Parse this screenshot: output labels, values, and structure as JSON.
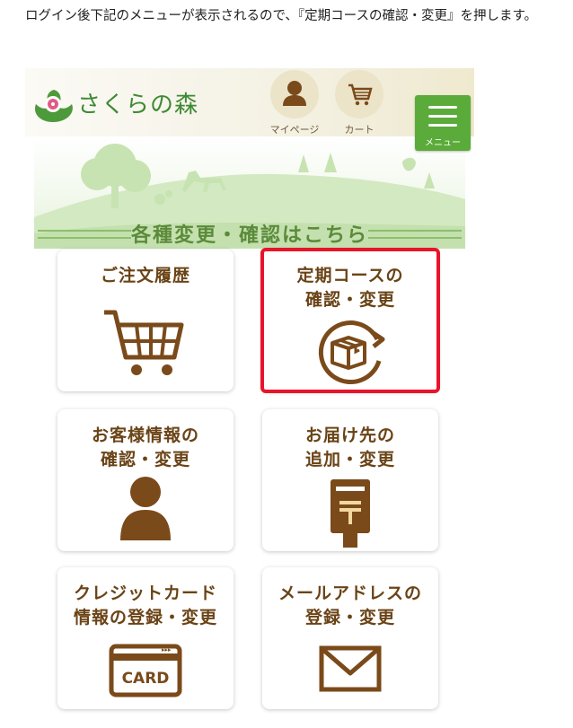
{
  "intro": {
    "text": "ログイン後下記のメニューが表示されるので、『定期コースの確認・変更』を押します。"
  },
  "header": {
    "logo_text": "さくらの森",
    "mypage_label": "マイページ",
    "cart_label": "カート",
    "menu_label": "メニュー"
  },
  "section": {
    "title": "各種変更・確認はこちら"
  },
  "cards": [
    {
      "title": "ご注文履歴",
      "icon": "shopping-cart-icon"
    },
    {
      "title": "定期コースの\n確認・変更",
      "icon": "recurring-box-icon"
    },
    {
      "title": "お客様情報の\n確認・変更",
      "icon": "person-icon"
    },
    {
      "title": "お届け先の\n追加・変更",
      "icon": "mailbox-icon"
    },
    {
      "title": "クレジットカード\n情報の登録・変更",
      "icon": "credit-card-icon",
      "card_text": "CARD"
    },
    {
      "title": "メールアドレスの\n登録・変更",
      "icon": "envelope-icon"
    }
  ],
  "colors": {
    "brand_green": "#3e8a34",
    "icon_brown": "#7a4a1a",
    "highlight_red": "#e8152a"
  }
}
